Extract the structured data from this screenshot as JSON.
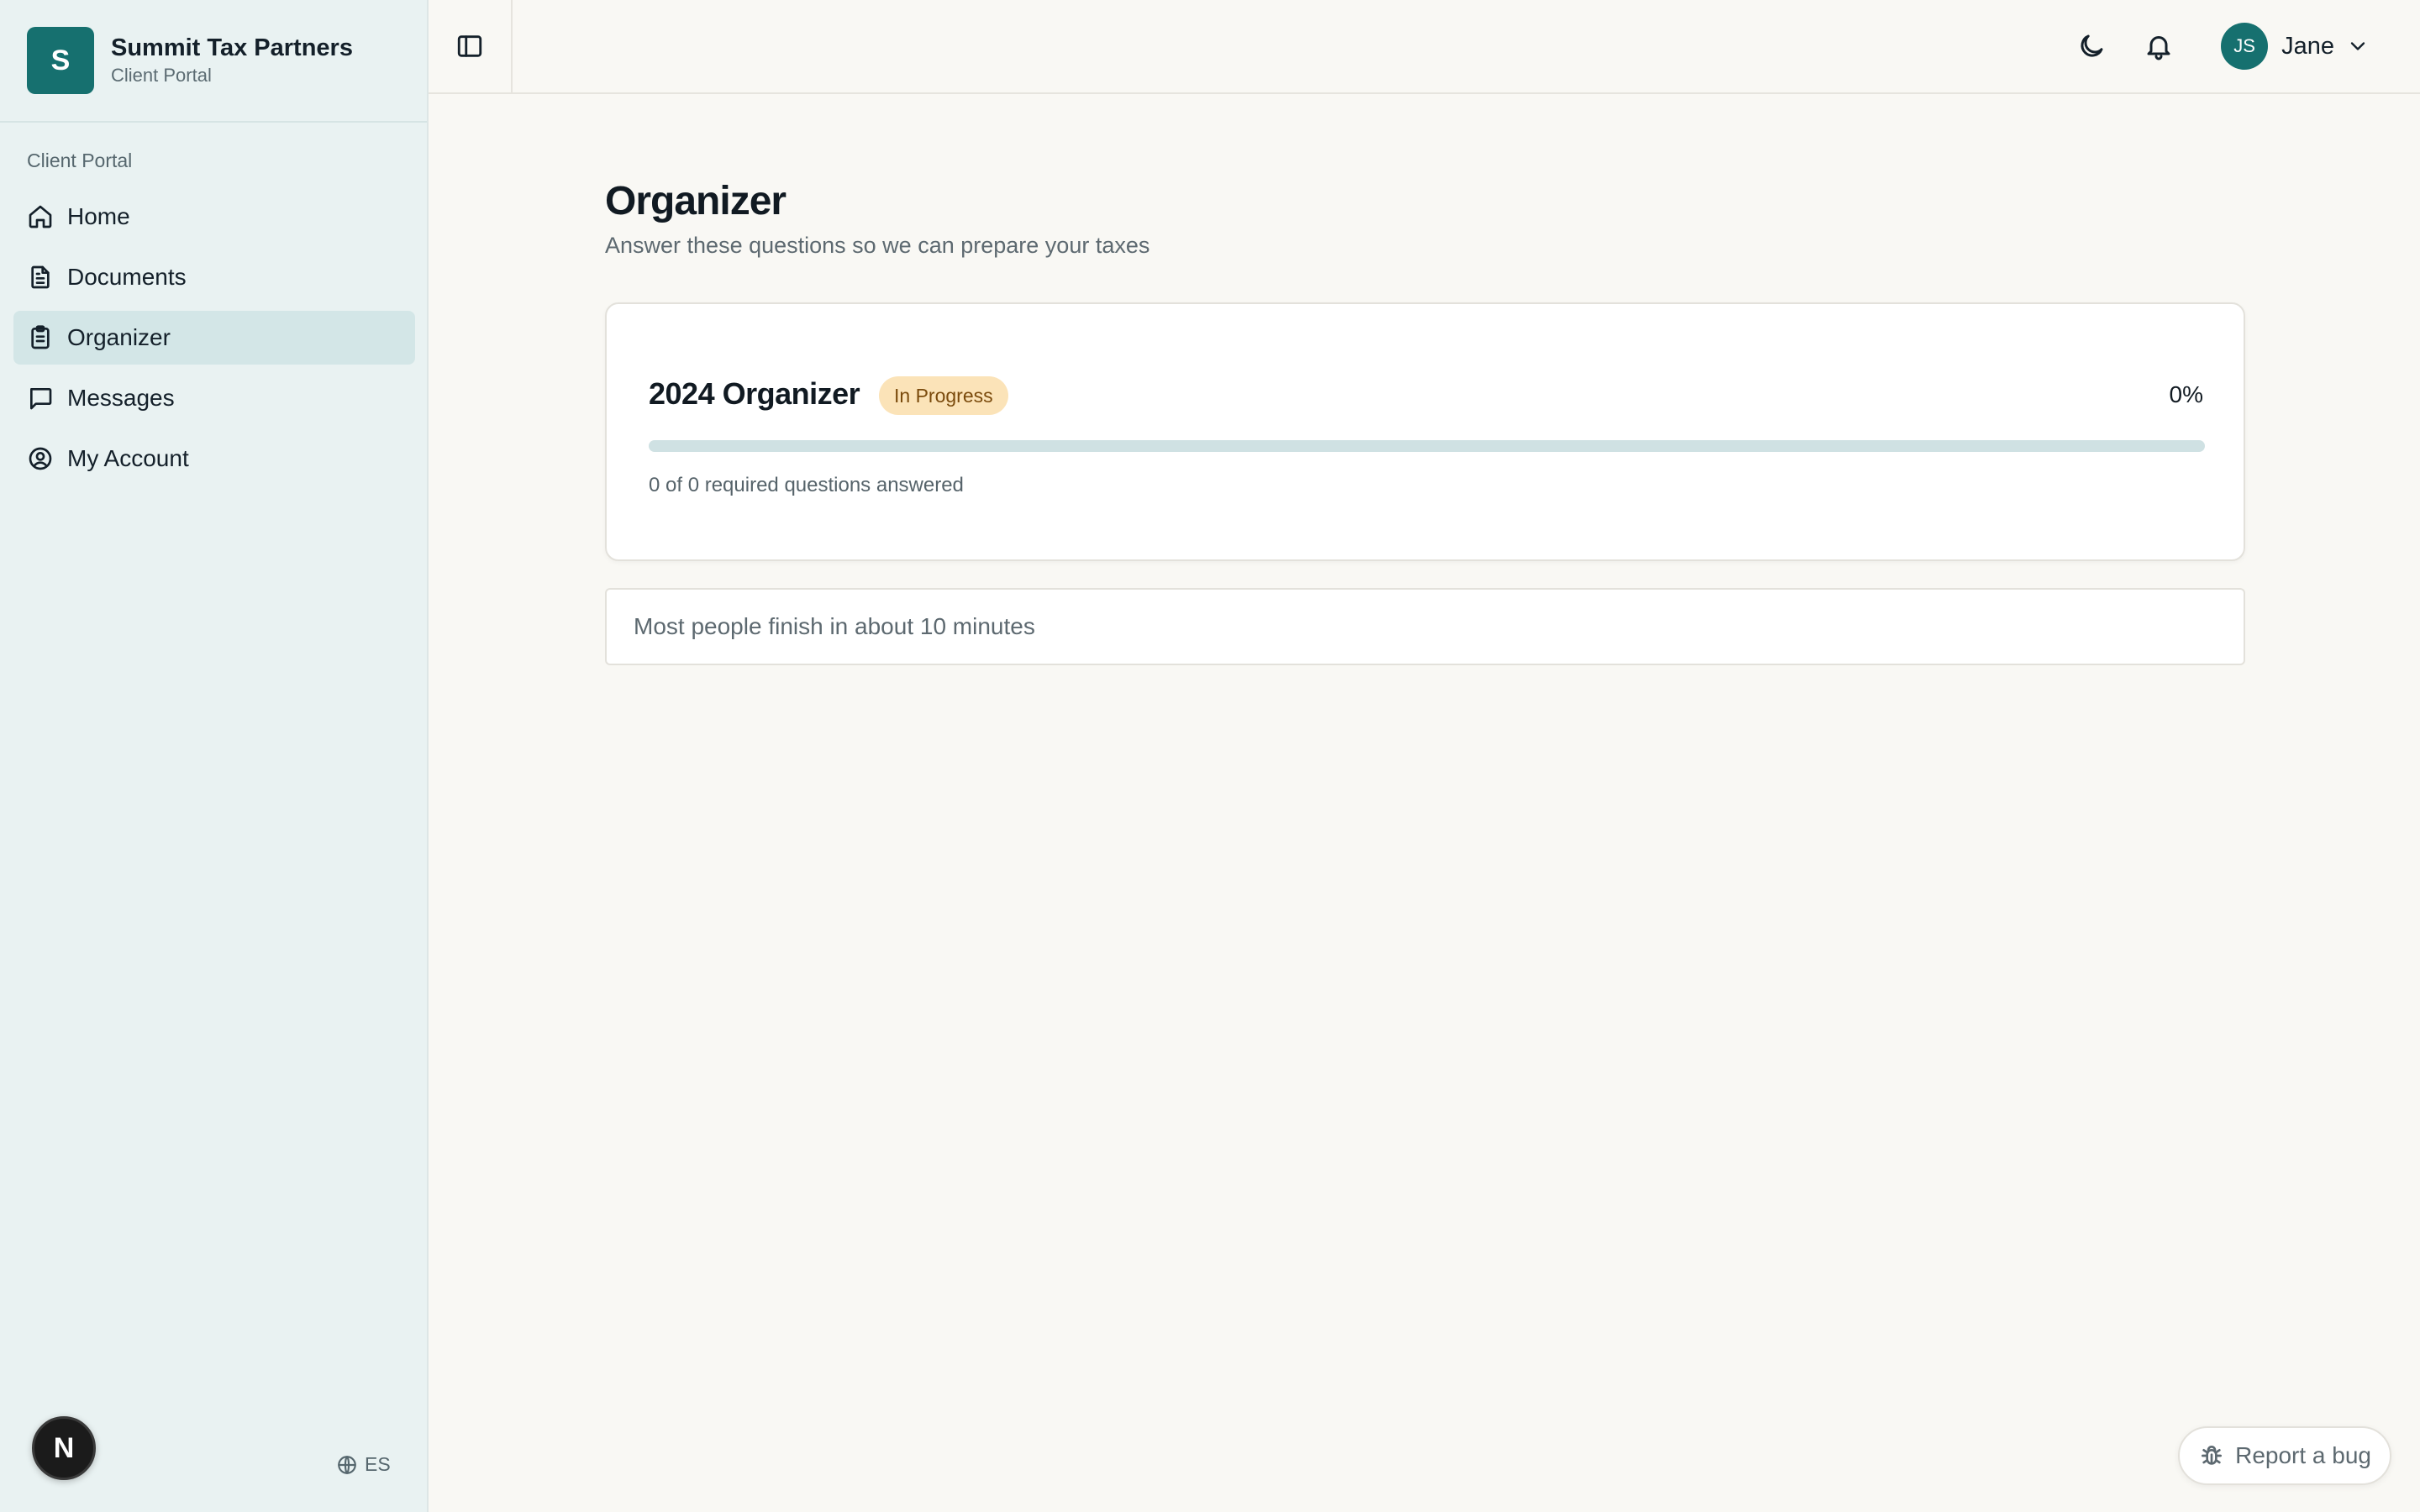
{
  "brand": {
    "logo_letter": "S",
    "name": "Summit Tax Partners",
    "subtitle": "Client Portal"
  },
  "sidebar": {
    "section_label": "Client Portal",
    "items": [
      {
        "label": "Home",
        "icon": "home-icon"
      },
      {
        "label": "Documents",
        "icon": "document-icon"
      },
      {
        "label": "Organizer",
        "icon": "clipboard-icon",
        "active": true
      },
      {
        "label": "Messages",
        "icon": "message-icon"
      },
      {
        "label": "My Account",
        "icon": "user-circle-icon"
      }
    ],
    "avatar_letter": "N",
    "language": "ES"
  },
  "header": {
    "user_initials": "JS",
    "user_name": "Jane"
  },
  "page": {
    "title": "Organizer",
    "subtitle": "Answer these questions so we can prepare your taxes"
  },
  "organizer_card": {
    "title": "2024 Organizer",
    "status": "In Progress",
    "percent": "0%",
    "progress_value": 0,
    "progress_text": "0 of 0 required questions answered"
  },
  "note": "Most people finish in about 10 minutes",
  "report_bug": "Report a bug",
  "colors": {
    "accent": "#16706f",
    "badge_bg": "#fbe3b8",
    "badge_text": "#7a4a0c"
  }
}
